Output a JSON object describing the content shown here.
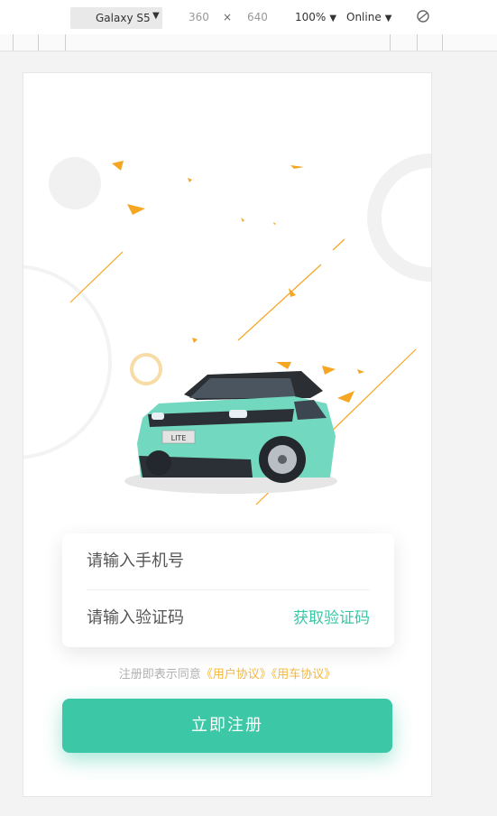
{
  "devtools": {
    "device": "Galaxy S5",
    "width": "360",
    "times": "×",
    "height": "640",
    "zoom": "100%",
    "network": "Online",
    "rotate_icon": "rotate-icon"
  },
  "form": {
    "phone_placeholder": "请输入手机号",
    "code_placeholder": "请输入验证码",
    "get_code": "获取验证码"
  },
  "agreement": {
    "prefix": "注册即表示同意",
    "user_agreement": "《用户协议》",
    "car_agreement": "《用车协议》"
  },
  "register_button": "立即注册",
  "car_badge": "LITE",
  "colors": {
    "accent": "#3cc8a6",
    "link": "#f4b63c",
    "decoration": "#f5a623"
  }
}
